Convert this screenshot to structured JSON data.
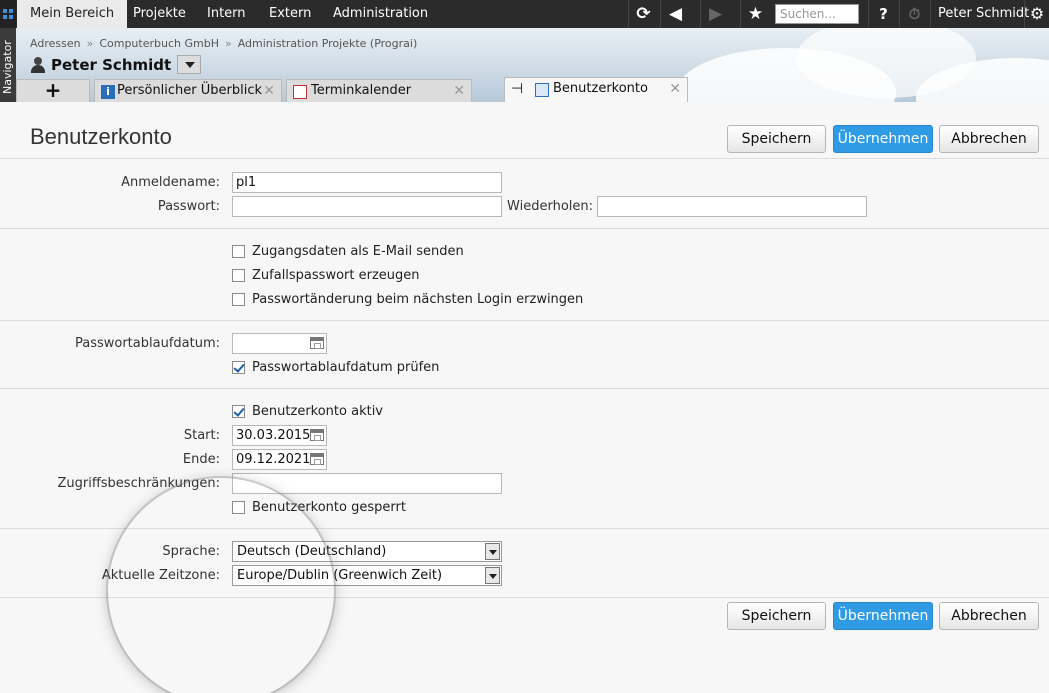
{
  "topbar": {
    "tabs": [
      "Mein Bereich",
      "Projekte",
      "Intern",
      "Extern",
      "Administration"
    ],
    "active_tab": "Mein Bereich",
    "search_placeholder": "Suchen...",
    "help_label": "?",
    "user_name": "Peter Schmidt",
    "icons": [
      "refresh-icon",
      "back-icon",
      "forward-icon",
      "star-icon",
      "help-icon",
      "timer-icon",
      "gear-icon"
    ]
  },
  "navigator": {
    "label": "Navigator"
  },
  "breadcrumb": [
    "Adressen",
    "Computerbuch GmbH",
    "Administration Projekte (Prograi)"
  ],
  "breadcrumb_separator": "»",
  "person_title": "Peter Schmidt",
  "tabs": [
    {
      "label": "+"
    },
    {
      "label": "Persönlicher Überblick"
    },
    {
      "label": "Terminkalender"
    },
    {
      "label": "Benutzerkonto"
    }
  ],
  "page": {
    "title": "Benutzerkonto",
    "buttons": {
      "save": "Speichern",
      "apply": "Übernehmen",
      "cancel": "Abbrechen"
    }
  },
  "form": {
    "login_label": "Anmeldename:",
    "login_value": "pl1",
    "password_label": "Passwort:",
    "password_value": "",
    "repeat_label": "Wiederholen:",
    "repeat_value": "",
    "send_email": {
      "label": "Zugangsdaten als E-Mail senden",
      "checked": false
    },
    "random_password": {
      "label": "Zufallspasswort erzeugen",
      "checked": false
    },
    "force_change": {
      "label": "Passwortänderung beim nächsten Login erzwingen",
      "checked": false
    },
    "expiry_label": "Passwortablaufdatum:",
    "expiry_value": "",
    "check_expiry": {
      "label": "Passwortablaufdatum prüfen",
      "checked": true
    },
    "account_active": {
      "label": "Benutzerkonto aktiv",
      "checked": true
    },
    "start_label": "Start:",
    "start_value": "30.03.2015",
    "end_label": "Ende:",
    "end_value": "09.12.2021",
    "access_label": "Zugriffsbeschränkungen:",
    "access_value": "",
    "account_locked": {
      "label": "Benutzerkonto gesperrt",
      "checked": false
    },
    "language_label": "Sprache:",
    "language_value": "Deutsch (Deutschland)",
    "timezone_label": "Aktuelle Zeitzone:",
    "timezone_value": "Europe/Dublin (Greenwich Zeit)"
  },
  "colors": {
    "primary_button": "#2f9be5",
    "topbar": "#2b2b2b"
  }
}
